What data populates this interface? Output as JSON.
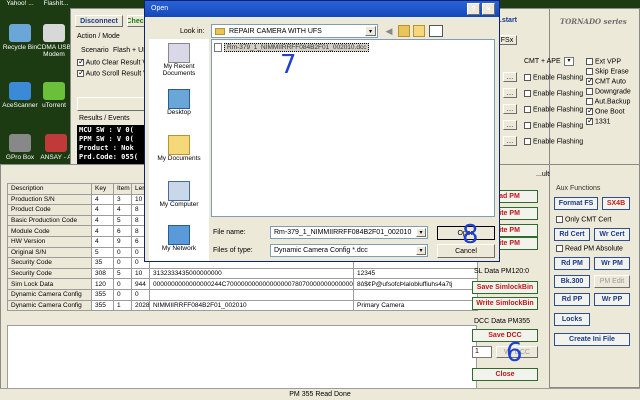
{
  "desktop": {
    "icons": [
      {
        "label": "Recycle Bin",
        "color": "#6aa7d8"
      },
      {
        "label": "CDMA USB Modem",
        "color": "#d8d8d8"
      },
      {
        "label": "AceScanner",
        "color": "#3a8ad8"
      },
      {
        "label": "uTorrent",
        "color": "#6ac03a"
      },
      {
        "label": "GPro Box",
        "color": "#888888"
      },
      {
        "label": "ANSAY - A",
        "color": "#c03a3a"
      }
    ],
    "top_labels": [
      "Yahoo! ...",
      "FlashIt..."
    ]
  },
  "tool": {
    "disconnect": "Disconnect",
    "check": "Check",
    "action_mode": "Action / Mode",
    "scenario": "Scenario",
    "flash_ui": "Flash + UI",
    "auto_clear": "Auto Clear Result V",
    "auto_scroll": "Auto Scroll Result V",
    "results_events": "Results / Events",
    "log_lines": [
      "MCU SW  : V 0(",
      "PPM SW  : V 0(",
      "Product : Nok",
      "Prd.Code: 055("
    ],
    "restart": "...start",
    "brand": "TORNADO series",
    "tab_fsx": "FSx",
    "cmt_ape": "CMT + APE",
    "enable_flashing": "Enable Flashing",
    "ext_vpp": "Ext VPP",
    "skip_erase": "Skip Erase",
    "cmt_auto": "CMT Auto",
    "downgrade": "Downgrade",
    "aut_backup": "Aut.Backup",
    "one_boot": "One Boot",
    "v1331": "1331"
  },
  "pm_table": {
    "headers": [
      "Description",
      "Key",
      "Item",
      "Len",
      "",
      ""
    ],
    "rows": [
      [
        "Production S/N",
        "4",
        "3",
        "10",
        "",
        ""
      ],
      [
        "Product Code",
        "4",
        "4",
        "8",
        "",
        ""
      ],
      [
        "Basic Production Code",
        "4",
        "5",
        "8",
        "",
        ""
      ],
      [
        "Module Code",
        "4",
        "6",
        "8",
        "",
        ""
      ],
      [
        "HW Version",
        "4",
        "9",
        "6",
        "",
        ""
      ],
      [
        "Original S/N",
        "5",
        "0",
        "0",
        "",
        ""
      ],
      [
        "Security Code",
        "35",
        "0",
        "0",
        "",
        ""
      ],
      [
        "Security Code",
        "308",
        "5",
        "10",
        "3132333435000000000",
        "12345"
      ],
      [
        "Sim Lock Data",
        "120",
        "0",
        "944",
        "0000000000000000244C70000000000000000078070000000000000000",
        "8ô$¢P@ufsofcÞlalobluffiuhs4a7tj"
      ],
      [
        "Dynamic Camera Config",
        "355",
        "0",
        "0",
        "",
        ""
      ],
      [
        "Dynamic Camera Config",
        "355",
        "1",
        "2028",
        "NIMMIIRRFF084B2F01_002010",
        "Primary Camera"
      ]
    ]
  },
  "pm_panel": {
    "read_pm": "Read PM",
    "write_pm": "Write PM",
    "sl_data": "SL Data PM120:0",
    "save_simlock": "Save SimlockBin",
    "write_simlock": "Write SimlockBin",
    "dcc_data": "DCC Data PM355",
    "save_dcc": "Save DCC",
    "spin_value": "1",
    "write_dcc": "Wr DCC",
    "close": "Close",
    "side_label": "...ults"
  },
  "aux": {
    "title": "Aux Functions",
    "format_fs": "Format FS",
    "sx4": "SX4B",
    "only_cmt": "Only CMT Cert",
    "rd_cert": "Rd Cert",
    "wr_cert": "Wr Cert",
    "read_pm_absolute": "Read PM Absolute",
    "rd_pm": "Rd PM",
    "wr_pm": "Wr PM",
    "bk300": "Bk.300",
    "pm_edit": "PM Edit",
    "rd_pp": "Rd PP",
    "wr_pp": "Wr PP",
    "locks": "Locks",
    "create_ini": "Create Ini File"
  },
  "status_bar": "PM 355 Read Done",
  "open_dialog": {
    "title": "Open",
    "help": "?",
    "close": "×",
    "look_in_label": "Look in:",
    "look_in_value": "REPAIR CAMERA WITH UFS",
    "places": [
      "My Recent Documents",
      "Desktop",
      "My Documents",
      "My Computer",
      "My Network"
    ],
    "file_item": "Rm-379_1_NIMMIIRRFF084B2F01_002010.dcc",
    "file_name_label": "File name:",
    "file_name_value": "Rm-379_1_NIMMIIRRFF084B2F01_002010",
    "file_type_label": "Files of type:",
    "file_type_value": "Dynamic Camera Config *.dcc",
    "open_button": "Open",
    "cancel_button": "Cancel"
  },
  "annotations": [
    "7",
    "8",
    "6"
  ]
}
